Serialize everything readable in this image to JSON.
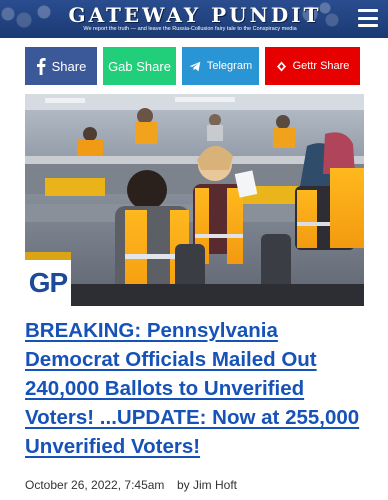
{
  "header": {
    "brand": "GATEWAY PUNDIT",
    "tagline": "We report the truth — and leave the Russia-Collusion fairy tale to the Conspiracy media"
  },
  "share": {
    "facebook": "Share",
    "gab": "Gab Share",
    "telegram": "Telegram",
    "gettr": "Gettr Share"
  },
  "colors": {
    "facebook": "#3b5998",
    "gab": "#21cf7a",
    "telegram": "#2a95d4",
    "gettr": "#e60000",
    "headline": "#1652b8",
    "header_bg": "#1b3a73"
  },
  "photo": {
    "badge": "GP"
  },
  "article": {
    "headline": "BREAKING: Pennsylvania Democrat Officials Mailed Out 240,000 Ballots to Unverified Voters! ...UPDATE: Now at 255,000 Unverified Voters!",
    "date": "October 26, 2022, 7:45am",
    "author": "by Jim Hoft"
  }
}
